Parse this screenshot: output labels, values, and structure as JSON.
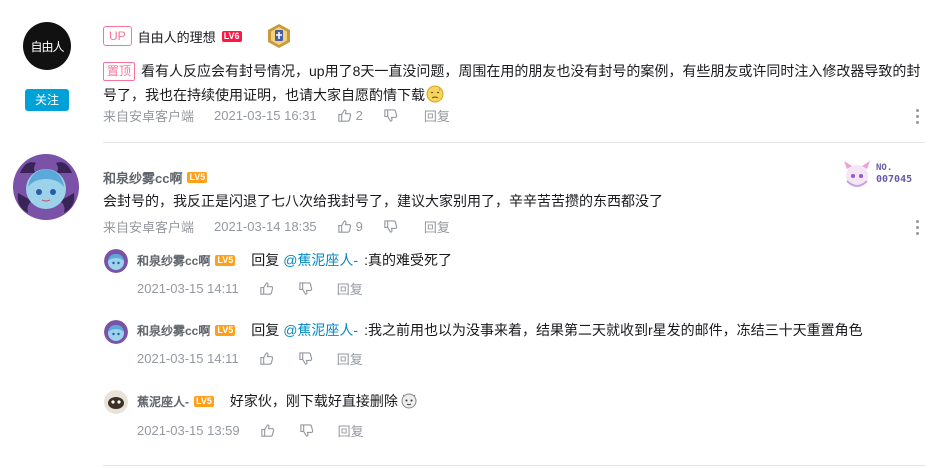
{
  "comments": [
    {
      "username": "自由人的理想",
      "up_tag": "UP",
      "level": "LV6",
      "level_color": "#ff6c00",
      "avatar_text": "自由人",
      "follow_label": "关注",
      "pin_tag": "置顶",
      "text": "看有人反应会有封号情况，up用了8天一直没问题，周围在用的朋友也没有封号的案例，有些朋友或许同时注入修改器导致的封号了，我也在持续使用证明，也请大家自愿酌情下载",
      "emoji": "sweat-emoji",
      "source": "来自安卓客户端",
      "time": "2021-03-15 16:31",
      "likes": "2",
      "reply_label": "回复"
    },
    {
      "username": "和泉纱雾cc啊",
      "level": "LV5",
      "level_color": "#ff6c00",
      "badge_text": "NO.",
      "badge_number": "007045",
      "text": "会封号的，我反正是闪退了七八次给我封号了，建议大家别用了，辛辛苦苦攒的东西都没了",
      "source": "来自安卓客户端",
      "time": "2021-03-14 18:35",
      "likes": "9",
      "reply_label": "回复",
      "replies": [
        {
          "username": "和泉纱雾cc啊",
          "level": "LV5",
          "reply_prefix": "回复",
          "mention": "@蕉泥座人-",
          "text": ":真的难受死了",
          "time": "2021-03-15 14:11",
          "reply_label": "回复"
        },
        {
          "username": "和泉纱雾cc啊",
          "level": "LV5",
          "reply_prefix": "回复",
          "mention": "@蕉泥座人-",
          "text": ":我之前用也以为没事来着，结果第二天就收到r星发的邮件，冻结三十天重置角色",
          "time": "2021-03-15 14:11",
          "reply_label": "回复"
        },
        {
          "username": "蕉泥座人-",
          "level": "LV5",
          "text": "好家伙，刚下载好直接删除",
          "emoji": "cat-emoji",
          "time": "2021-03-15 13:59",
          "reply_label": "回复"
        }
      ]
    }
  ]
}
